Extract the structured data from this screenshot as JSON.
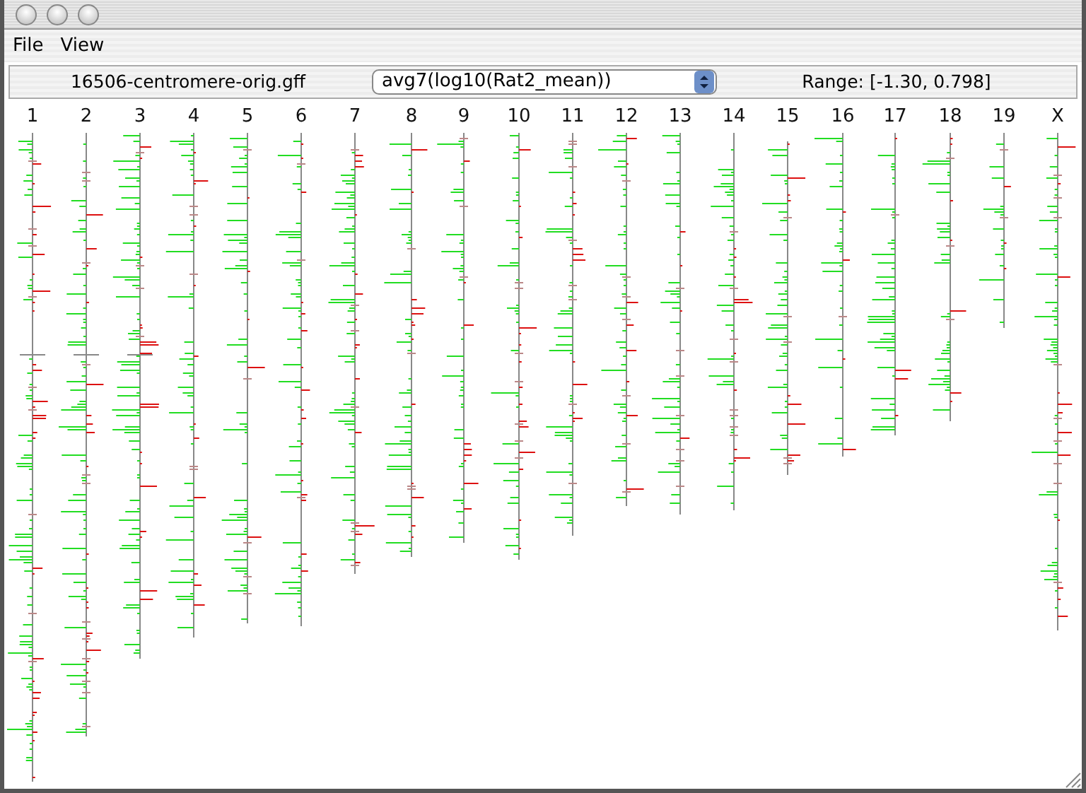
{
  "menu": [
    "File",
    "View"
  ],
  "toolbar": {
    "file": "16506-centromere-orig.gff",
    "dropdown": "avg7(log10(Rat2_mean))",
    "range": "Range: [-1.30, 0.798]"
  },
  "chromosomes": [
    {
      "label": "1"
    },
    {
      "label": "2"
    },
    {
      "label": "3"
    },
    {
      "label": "4"
    },
    {
      "label": "5"
    },
    {
      "label": "6"
    },
    {
      "label": "7"
    },
    {
      "label": "8"
    },
    {
      "label": "9"
    },
    {
      "label": "10"
    },
    {
      "label": "11"
    },
    {
      "label": "12"
    },
    {
      "label": "13"
    },
    {
      "label": "14"
    },
    {
      "label": "15"
    },
    {
      "label": "16"
    },
    {
      "label": "17"
    },
    {
      "label": "18"
    },
    {
      "label": "19"
    },
    {
      "label": "X"
    }
  ]
}
